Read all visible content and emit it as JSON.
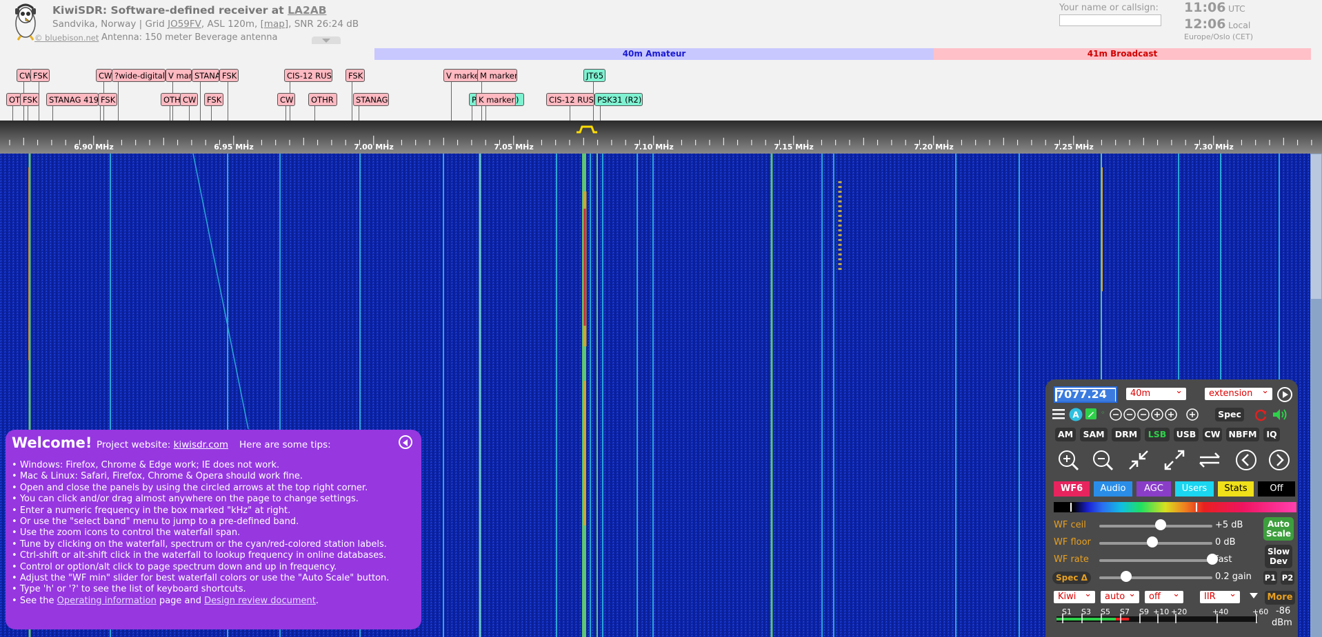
{
  "header": {
    "title_prefix": "KiwiSDR: Software-defined receiver at ",
    "title_callsign": "LA2AB",
    "location_prefix": "Sandvika, Norway | Grid ",
    "grid": "JO59FV",
    "location_mid": ", ASL 120m, ",
    "map_link": "[map]",
    "snr": ", SNR 26:24 dB",
    "credit": "© bluebison.net",
    "antenna": "Antenna: 150 meter Beverage antenna",
    "callsign_label": "Your name or callsign:",
    "callsign_value": "",
    "utc_time": "11:06",
    "utc_label": "UTC",
    "local_time": "12:06",
    "local_label": "Local",
    "timezone": "Europe/Oslo (CET)"
  },
  "bands": [
    {
      "label": "40m Amateur",
      "color": "#c8c8ff",
      "text_color": "#1a1ad0"
    },
    {
      "label": "41m Broadcast",
      "color": "#ffc0c8",
      "text_color": "#d00000"
    }
  ],
  "station_labels_row1": [
    "CW",
    "FSK",
    "CW",
    "?wide-digital",
    "V mar",
    "STANA",
    "FSK",
    "CIS-12 RUS",
    "FSK",
    "V marke",
    "M marker",
    "JT65"
  ],
  "station_labels_row2": [
    "OT",
    "FSK",
    "STANAG 419",
    "FSK",
    "OTH",
    "CW",
    "FSK",
    "CW",
    "OTHR",
    "STANAG",
    "P",
    "K marker",
    ")",
    "CIS-12 RUS",
    "PSK31 (R2)"
  ],
  "frequency_scale": [
    "6.90 MHz",
    "6.95 MHz",
    "7.00 MHz",
    "7.05 MHz",
    "7.10 MHz",
    "7.15 MHz",
    "7.20 MHz",
    "7.25 MHz",
    "7.30 MHz"
  ],
  "welcome": {
    "title": "Welcome!",
    "project_label": "Project website: ",
    "project_link": "kiwisdr.com",
    "tips_intro": "Here are some tips:",
    "tips": [
      "Windows: Firefox, Chrome & Edge work; IE does not work.",
      "Mac & Linux: Safari, Firefox, Chrome & Opera should work fine.",
      "Open and close the panels by using the circled arrows at the top right corner.",
      "You can click and/or drag almost anywhere on the page to change settings.",
      "Enter a numeric frequency in the box marked \"kHz\" at right.",
      "Or use the \"select band\" menu to jump to a pre-defined band.",
      "Use the zoom icons to control the waterfall span.",
      "Tune by clicking on the waterfall, spectrum or the cyan/red-colored station labels.",
      "Ctrl-shift or alt-shift click in the waterfall to lookup frequency in online databases.",
      "Control or option/alt click to page spectrum down and up in frequency.",
      "Adjust the \"WF min\" slider for best waterfall colors or use the \"Auto Scale\" button.",
      "Type 'h' or '?' to see the list of keyboard shortcuts."
    ],
    "last_tip_prefix": "See the ",
    "last_tip_link1": "Operating information",
    "last_tip_mid": " page and ",
    "last_tip_link2": "Design review document",
    "last_tip_suffix": "."
  },
  "control": {
    "frequency": "7077.24",
    "band_select": "40m",
    "extension_select": "extension",
    "spec_button": "Spec",
    "modes": [
      "AM",
      "SAM",
      "DRM",
      "LSB",
      "USB",
      "CW",
      "NBFM",
      "IQ"
    ],
    "active_mode": "LSB",
    "wf_tabs": [
      {
        "label": "WF6",
        "color": "#e8245e"
      },
      {
        "label": "Audio",
        "color": "#2a8ee8"
      },
      {
        "label": "AGC",
        "color": "#8a3ec8"
      },
      {
        "label": "Users",
        "color": "#1ad6f0"
      },
      {
        "label": "Stats",
        "color": "#f0e01a"
      },
      {
        "label": "Off",
        "color": "#000000"
      }
    ],
    "sliders": [
      {
        "label": "WF ceil",
        "value": "+5 dB",
        "position": 0.54
      },
      {
        "label": "WF floor",
        "value": "0 dB",
        "position": 0.47
      },
      {
        "label": "WF rate",
        "value": "fast",
        "position": 1.0
      }
    ],
    "spec_delta_label": "Spec Δ",
    "spec_gain_value": "0.2 gain",
    "spec_gain_position": 0.24,
    "auto_scale": "Auto\nScale",
    "slow_dev": "Slow\nDev",
    "p1": "P1",
    "p2": "P2",
    "bottom_selects": [
      "Kiwi",
      "auto",
      "off",
      "IIR"
    ],
    "more_button": "More",
    "smeter_scale": [
      "S1",
      "S3",
      "S5",
      "S7",
      "S9",
      "+10",
      "+20",
      "+40",
      "+60"
    ],
    "smeter_value": "-86",
    "smeter_unit": "dBm",
    "smeter_level": 0.36
  }
}
